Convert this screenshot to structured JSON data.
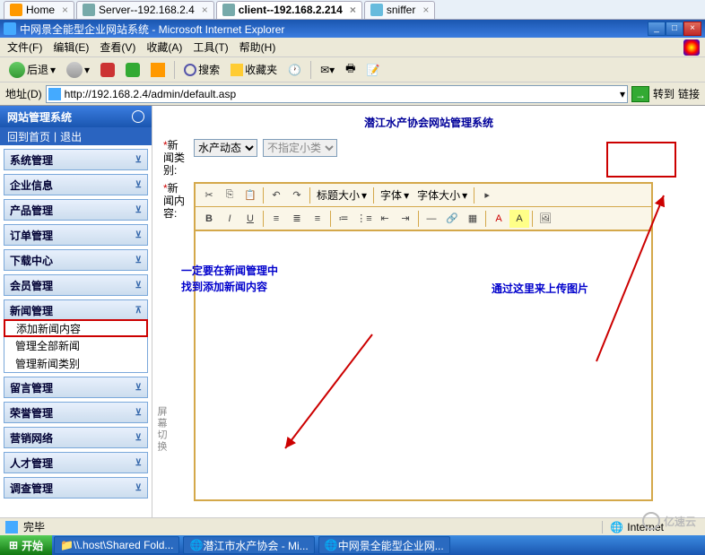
{
  "tabs": [
    {
      "label": "Home",
      "icon": "home"
    },
    {
      "label": "Server--192.168.2.4",
      "icon": "server"
    },
    {
      "label": "client--192.168.2.214",
      "icon": "client",
      "active": true
    },
    {
      "label": "sniffer",
      "icon": "sniffer"
    }
  ],
  "ie": {
    "title": "中网景全能型企业网站系统 - Microsoft Internet Explorer",
    "menu": [
      "文件(F)",
      "编辑(E)",
      "查看(V)",
      "收藏(A)",
      "工具(T)",
      "帮助(H)"
    ],
    "back": "后退",
    "addr_label": "地址(D)",
    "url": "http://192.168.2.4/admin/default.asp",
    "go": "转到",
    "links": "链接",
    "status": "完毕",
    "zone": "Internet"
  },
  "sidebar": {
    "header": "网站管理系统",
    "home": "回到首页",
    "logout": "退出",
    "sections": [
      {
        "title": "系统管理"
      },
      {
        "title": "企业信息"
      },
      {
        "title": "产品管理"
      },
      {
        "title": "订单管理"
      },
      {
        "title": "下载中心"
      },
      {
        "title": "会员管理"
      },
      {
        "title": "新闻管理",
        "expanded": true,
        "items": [
          "添加新闻内容",
          "管理全部新闻",
          "管理新闻类别"
        ]
      },
      {
        "title": "留言管理"
      },
      {
        "title": "荣誉管理"
      },
      {
        "title": "营销网络"
      },
      {
        "title": "人才管理"
      },
      {
        "title": "调查管理"
      }
    ]
  },
  "main": {
    "title": "潜江水产协会网站管理系统",
    "category_label": "新闻类别:",
    "category1": "水产动态",
    "category2": "不指定小类",
    "content_label": "新闻内容:",
    "heading_size": "标题大小",
    "font": "字体",
    "font_size": "字体大小"
  },
  "annotations": {
    "left1": "一定要在新闻管理中",
    "left2": "找到添加新闻内容",
    "right": "通过这里来上传图片"
  },
  "vtext": "屏幕切换",
  "taskbar": {
    "start": "开始",
    "items": [
      "\\\\.host\\Shared Fold...",
      "潜江市水产协会 - Mi...",
      "中网景全能型企业网..."
    ]
  },
  "watermark": "亿速云"
}
